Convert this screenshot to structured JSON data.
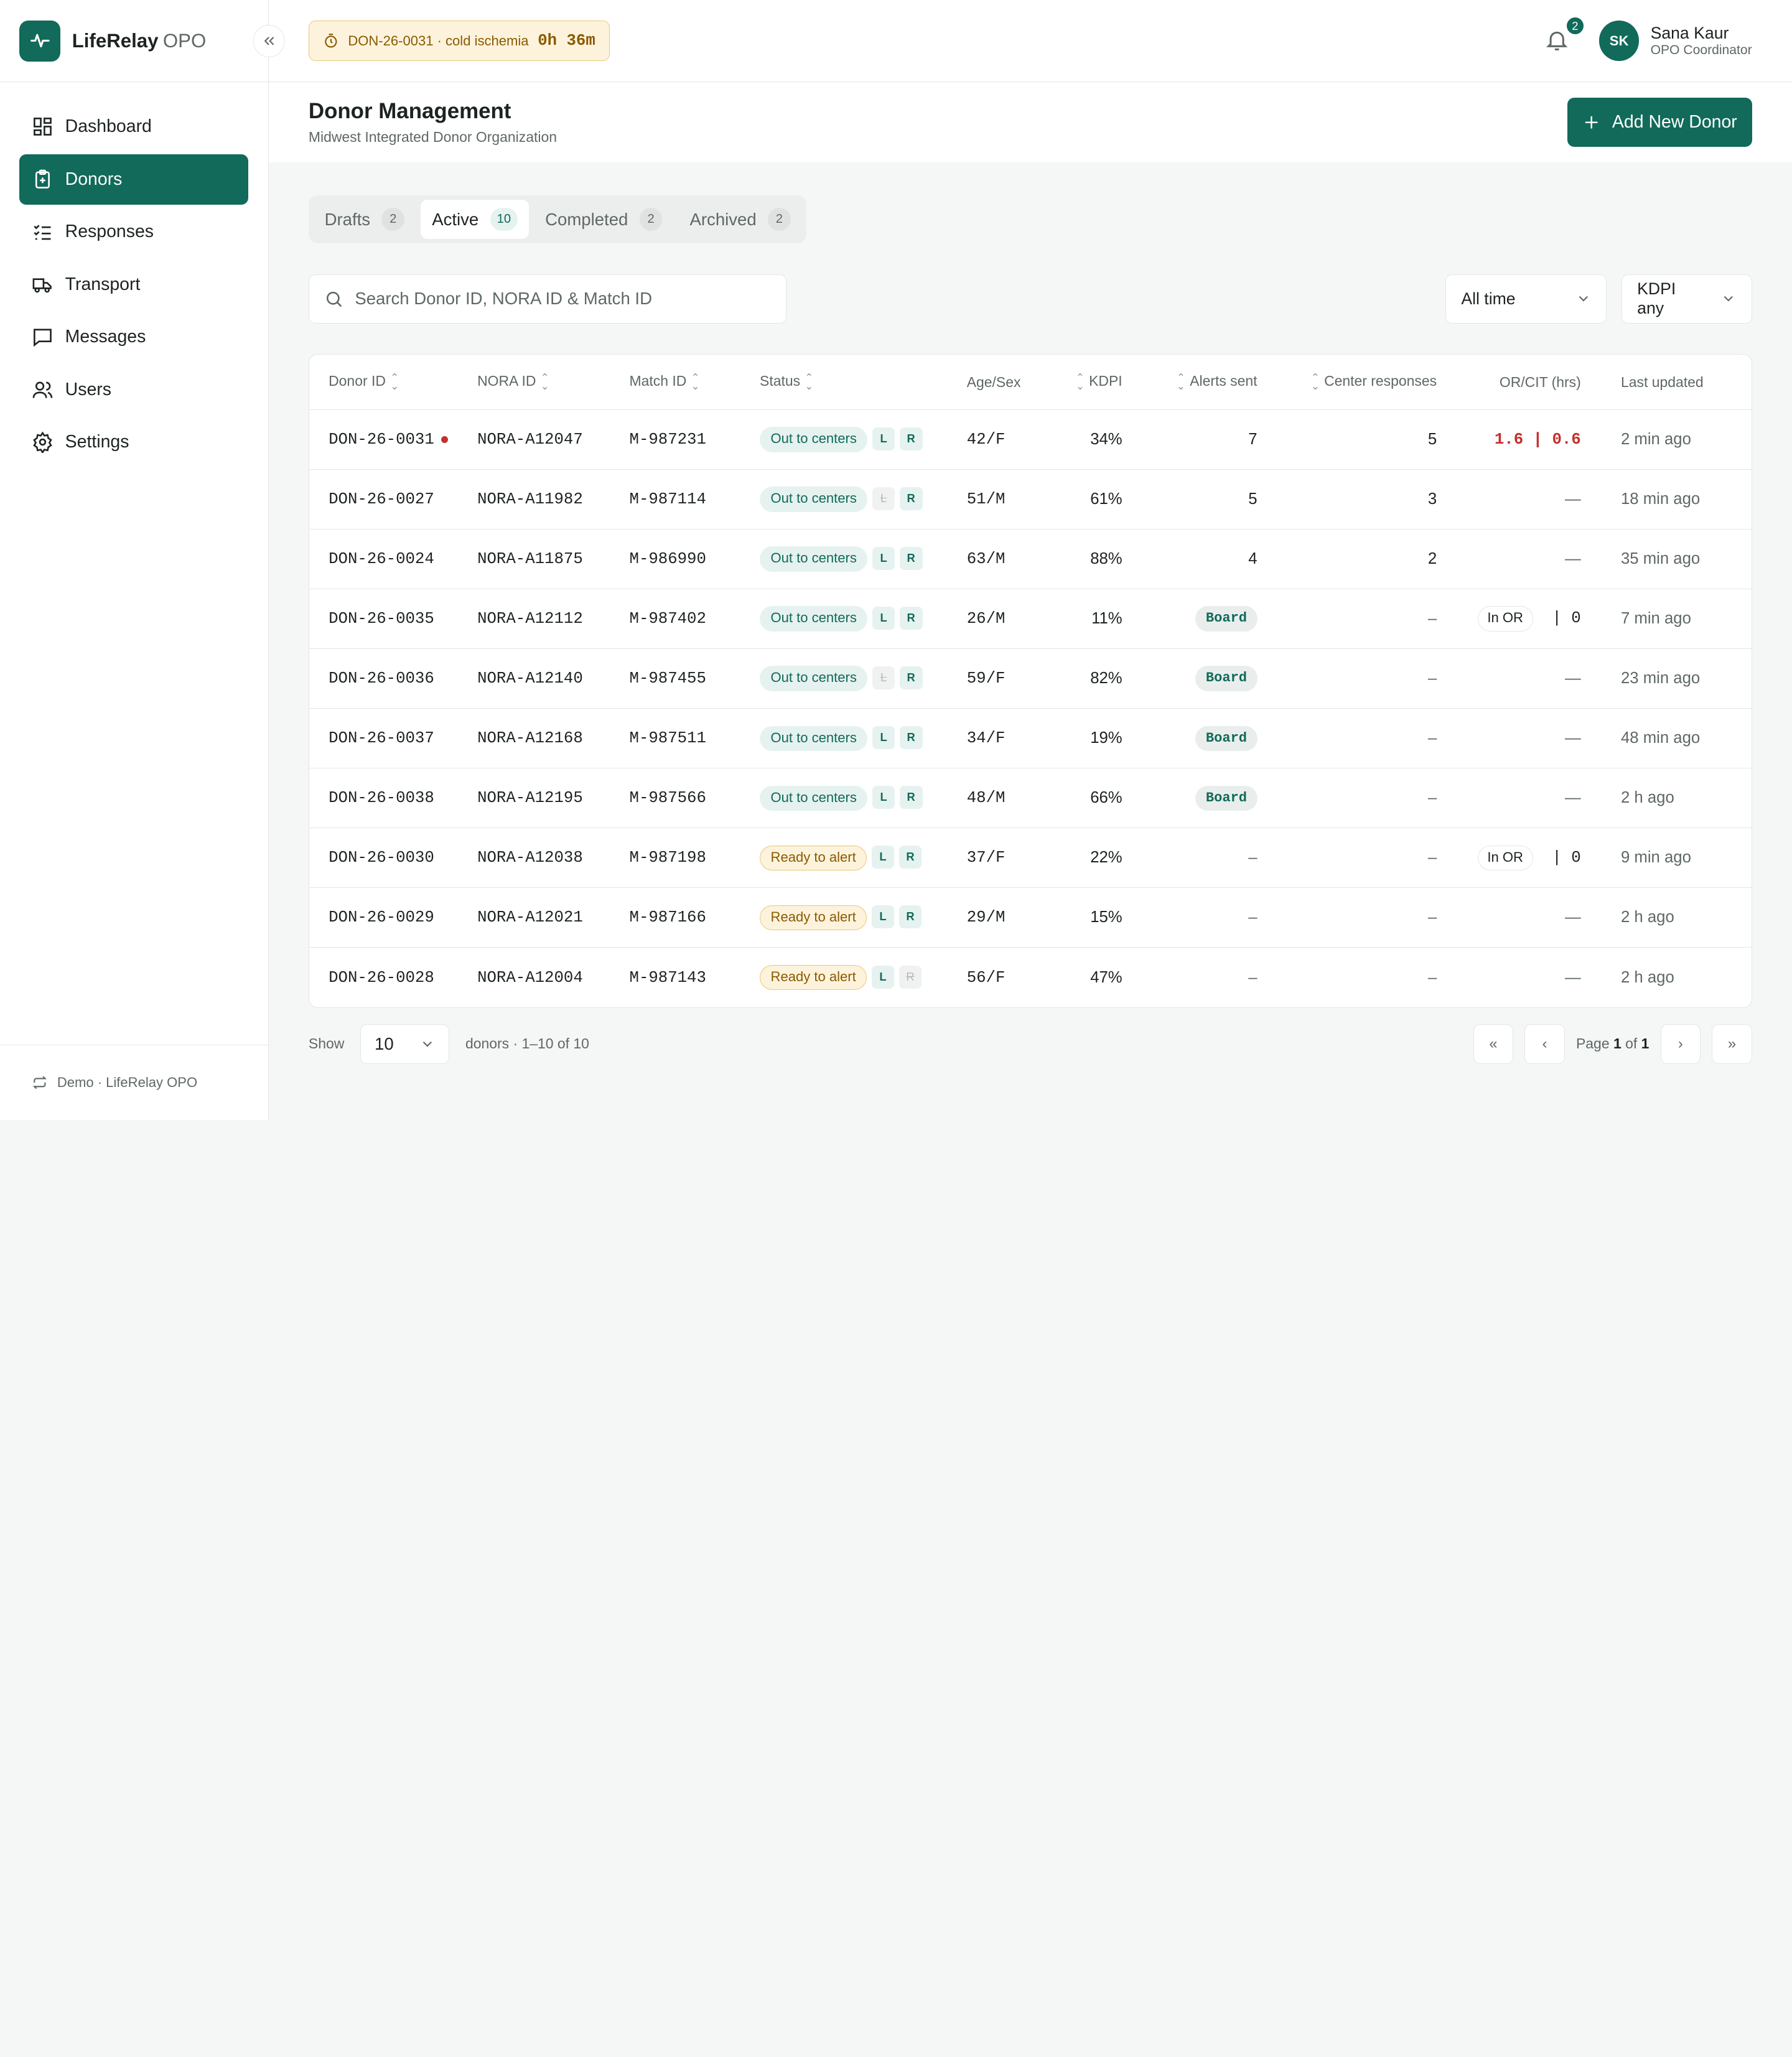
{
  "brand": {
    "name": "LifeRelay",
    "suffix": "OPO"
  },
  "sidebar": {
    "items": [
      {
        "label": "Dashboard",
        "icon": "dashboard-icon"
      },
      {
        "label": "Donors",
        "icon": "clipboard-icon",
        "active": true
      },
      {
        "label": "Responses",
        "icon": "checklist-icon"
      },
      {
        "label": "Transport",
        "icon": "truck-icon"
      },
      {
        "label": "Messages",
        "icon": "message-icon"
      },
      {
        "label": "Users",
        "icon": "users-icon"
      },
      {
        "label": "Settings",
        "icon": "gear-icon"
      }
    ],
    "footer": "Demo · LifeRelay OPO"
  },
  "topbar": {
    "cit_label": "DON-26-0031 · cold ischemia",
    "cit_time": "0h 36m",
    "notifications": "2",
    "user": {
      "initials": "SK",
      "name": "Sana Kaur",
      "role": "OPO Coordinator"
    }
  },
  "page": {
    "title": "Donor Management",
    "subtitle": "Midwest Integrated Donor Organization",
    "add_button": "Add New Donor"
  },
  "tabs": [
    {
      "label": "Drafts",
      "count": "2"
    },
    {
      "label": "Active",
      "count": "10",
      "active": true
    },
    {
      "label": "Completed",
      "count": "2"
    },
    {
      "label": "Archived",
      "count": "2"
    }
  ],
  "search": {
    "placeholder": "Search Donor ID, NORA ID & Match ID"
  },
  "filters": {
    "time": "All time",
    "kdpi": "KDPI any"
  },
  "table": {
    "headers": {
      "donor_id": "Donor ID",
      "nora_id": "NORA ID",
      "match_id": "Match ID",
      "status": "Status",
      "age_sex": "Age/Sex",
      "kdpi": "KDPI",
      "alerts": "Alerts sent",
      "responses": "Center responses",
      "orcit": "OR/CIT (hrs)",
      "updated": "Last updated"
    },
    "rows": [
      {
        "donor": "DON-26-0031",
        "flag": true,
        "nora": "NORA-A12047",
        "match": "M-987231",
        "status": "Out to centers",
        "status_type": "out",
        "L": true,
        "R": true,
        "age": "42/F",
        "kdpi": "34%",
        "alerts": "7",
        "responses": "5",
        "or": "1.6",
        "cit": "0.6",
        "orcit_type": "red",
        "updated": "2 min ago"
      },
      {
        "donor": "DON-26-0027",
        "flag": false,
        "nora": "NORA-A11982",
        "match": "M-987114",
        "status": "Out to centers",
        "status_type": "out",
        "L": false,
        "R": true,
        "age": "51/M",
        "kdpi": "61%",
        "alerts": "5",
        "responses": "3",
        "orcit": "—",
        "orcit_type": "dash",
        "updated": "18 min ago"
      },
      {
        "donor": "DON-26-0024",
        "flag": false,
        "nora": "NORA-A11875",
        "match": "M-986990",
        "status": "Out to centers",
        "status_type": "out",
        "L": true,
        "R": true,
        "age": "63/M",
        "kdpi": "88%",
        "alerts": "4",
        "responses": "2",
        "orcit": "—",
        "orcit_type": "dash",
        "updated": "35 min ago"
      },
      {
        "donor": "DON-26-0035",
        "flag": false,
        "nora": "NORA-A12112",
        "match": "M-987402",
        "status": "Out to centers",
        "status_type": "out",
        "L": true,
        "R": true,
        "age": "26/M",
        "kdpi": "11%",
        "alerts": "Board",
        "alerts_type": "board",
        "responses": "–",
        "or": "In OR",
        "cit": "0",
        "orcit_type": "inor",
        "updated": "7 min ago"
      },
      {
        "donor": "DON-26-0036",
        "flag": false,
        "nora": "NORA-A12140",
        "match": "M-987455",
        "status": "Out to centers",
        "status_type": "out",
        "L": false,
        "R": true,
        "age": "59/F",
        "kdpi": "82%",
        "alerts": "Board",
        "alerts_type": "board",
        "responses": "–",
        "orcit": "—",
        "orcit_type": "dash",
        "updated": "23 min ago"
      },
      {
        "donor": "DON-26-0037",
        "flag": false,
        "nora": "NORA-A12168",
        "match": "M-987511",
        "status": "Out to centers",
        "status_type": "out",
        "L": true,
        "R": true,
        "age": "34/F",
        "kdpi": "19%",
        "alerts": "Board",
        "alerts_type": "board",
        "responses": "–",
        "orcit": "—",
        "orcit_type": "dash",
        "updated": "48 min ago"
      },
      {
        "donor": "DON-26-0038",
        "flag": false,
        "nora": "NORA-A12195",
        "match": "M-987566",
        "status": "Out to centers",
        "status_type": "out",
        "L": true,
        "R": true,
        "age": "48/M",
        "kdpi": "66%",
        "alerts": "Board",
        "alerts_type": "board",
        "responses": "–",
        "orcit": "—",
        "orcit_type": "dash",
        "updated": "2 h ago"
      },
      {
        "donor": "DON-26-0030",
        "flag": false,
        "nora": "NORA-A12038",
        "match": "M-987198",
        "status": "Ready to alert",
        "status_type": "ready",
        "L": true,
        "R": true,
        "age": "37/F",
        "kdpi": "22%",
        "alerts": "–",
        "responses": "–",
        "or": "In OR",
        "cit": "0",
        "orcit_type": "inor",
        "updated": "9 min ago"
      },
      {
        "donor": "DON-26-0029",
        "flag": false,
        "nora": "NORA-A12021",
        "match": "M-987166",
        "status": "Ready to alert",
        "status_type": "ready",
        "L": true,
        "R": true,
        "age": "29/M",
        "kdpi": "15%",
        "alerts": "–",
        "responses": "–",
        "orcit": "—",
        "orcit_type": "dash",
        "updated": "2 h ago"
      },
      {
        "donor": "DON-26-0028",
        "flag": false,
        "nora": "NORA-A12004",
        "match": "M-987143",
        "status": "Ready to alert",
        "status_type": "ready",
        "L": true,
        "R": false,
        "age": "56/F",
        "kdpi": "47%",
        "alerts": "–",
        "responses": "–",
        "orcit": "—",
        "orcit_type": "dash",
        "updated": "2 h ago"
      }
    ]
  },
  "pagination": {
    "show_label": "Show",
    "page_size": "10",
    "range": "donors · 1–10 of 10",
    "page_prefix": "Page",
    "page_current": "1",
    "page_of": "of",
    "page_total": "1"
  },
  "colors": {
    "accent": "#116a5a",
    "alert_red": "#c4302b",
    "amber": "#fdf3dc"
  }
}
